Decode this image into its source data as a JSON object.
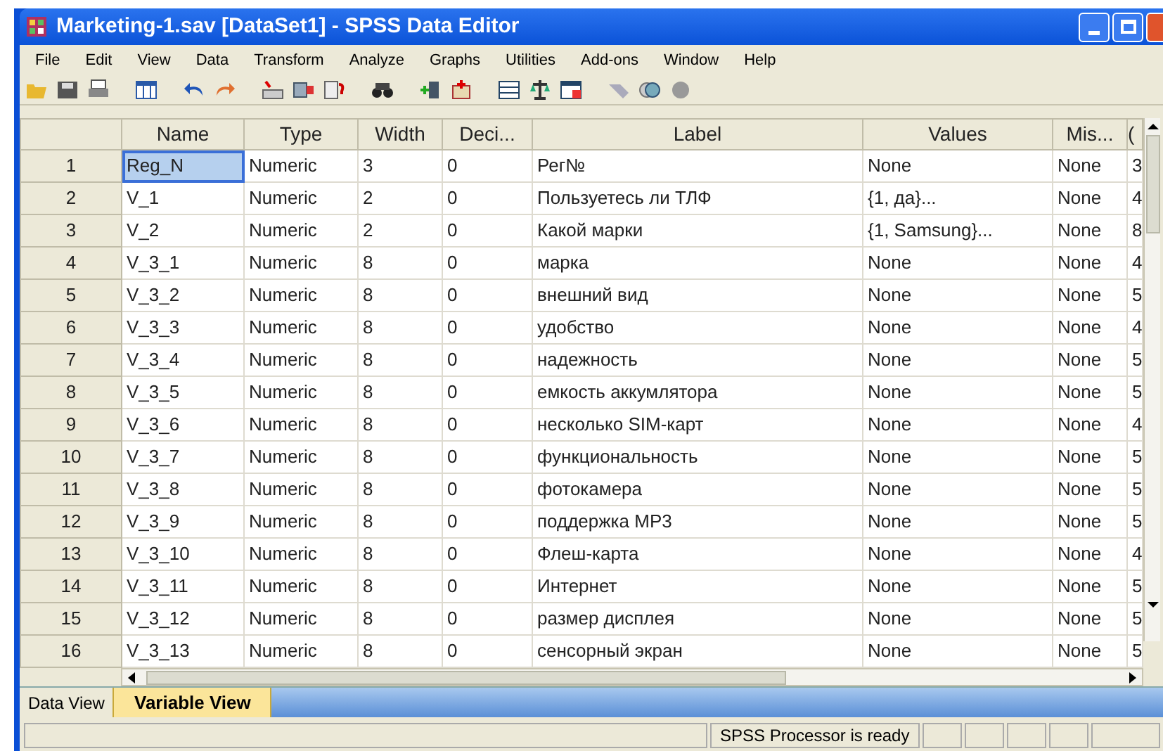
{
  "window": {
    "title": "Marketing-1.sav [DataSet1] - SPSS Data Editor"
  },
  "menu": [
    "File",
    "Edit",
    "View",
    "Data",
    "Transform",
    "Analyze",
    "Graphs",
    "Utilities",
    "Add-ons",
    "Window",
    "Help"
  ],
  "table": {
    "columns": [
      "Name",
      "Type",
      "Width",
      "Deci...",
      "Label",
      "Values",
      "Mis...",
      "("
    ],
    "rows": [
      {
        "number": "1",
        "selected": true,
        "cells": [
          "Reg_N",
          "Numeric",
          "3",
          "0",
          "Рег№",
          "None",
          "None",
          "3"
        ]
      },
      {
        "number": "2",
        "selected": false,
        "cells": [
          "V_1",
          "Numeric",
          "2",
          "0",
          "Пользуетесь ли ТЛФ",
          "{1, да}...",
          "None",
          "4"
        ]
      },
      {
        "number": "3",
        "selected": false,
        "cells": [
          "V_2",
          "Numeric",
          "2",
          "0",
          "Какой марки",
          "{1, Samsung}...",
          "None",
          "8"
        ]
      },
      {
        "number": "4",
        "selected": false,
        "cells": [
          "V_3_1",
          "Numeric",
          "8",
          "0",
          "марка",
          "None",
          "None",
          "4"
        ]
      },
      {
        "number": "5",
        "selected": false,
        "cells": [
          "V_3_2",
          "Numeric",
          "8",
          "0",
          "внешний вид",
          "None",
          "None",
          "5"
        ]
      },
      {
        "number": "6",
        "selected": false,
        "cells": [
          "V_3_3",
          "Numeric",
          "8",
          "0",
          "удобство",
          "None",
          "None",
          "4"
        ]
      },
      {
        "number": "7",
        "selected": false,
        "cells": [
          "V_3_4",
          "Numeric",
          "8",
          "0",
          "надежность",
          "None",
          "None",
          "5"
        ]
      },
      {
        "number": "8",
        "selected": false,
        "cells": [
          "V_3_5",
          "Numeric",
          "8",
          "0",
          "емкость аккумлятора",
          "None",
          "None",
          "5"
        ]
      },
      {
        "number": "9",
        "selected": false,
        "cells": [
          "V_3_6",
          "Numeric",
          "8",
          "0",
          "несколько SIM-карт",
          "None",
          "None",
          "4"
        ]
      },
      {
        "number": "10",
        "selected": false,
        "cells": [
          "V_3_7",
          "Numeric",
          "8",
          "0",
          "функциональность",
          "None",
          "None",
          "5"
        ]
      },
      {
        "number": "11",
        "selected": false,
        "cells": [
          "V_3_8",
          "Numeric",
          "8",
          "0",
          "фотокамера",
          "None",
          "None",
          "5"
        ]
      },
      {
        "number": "12",
        "selected": false,
        "cells": [
          "V_3_9",
          "Numeric",
          "8",
          "0",
          "поддержка MP3",
          "None",
          "None",
          "5"
        ]
      },
      {
        "number": "13",
        "selected": false,
        "cells": [
          "V_3_10",
          "Numeric",
          "8",
          "0",
          "Флеш-карта",
          "None",
          "None",
          "4"
        ]
      },
      {
        "number": "14",
        "selected": false,
        "cells": [
          "V_3_11",
          "Numeric",
          "8",
          "0",
          "Интернет",
          "None",
          "None",
          "5"
        ]
      },
      {
        "number": "15",
        "selected": false,
        "cells": [
          "V_3_12",
          "Numeric",
          "8",
          "0",
          "размер дисплея",
          "None",
          "None",
          "5"
        ]
      },
      {
        "number": "16",
        "selected": false,
        "cells": [
          "V_3_13",
          "Numeric",
          "8",
          "0",
          "сенсорный экран",
          "None",
          "None",
          "5"
        ]
      }
    ]
  },
  "tabs": [
    {
      "label": "Data View",
      "selected": false
    },
    {
      "label": "Variable View",
      "selected": true
    }
  ],
  "status_bar": {
    "message": "SPSS Processor is ready"
  }
}
